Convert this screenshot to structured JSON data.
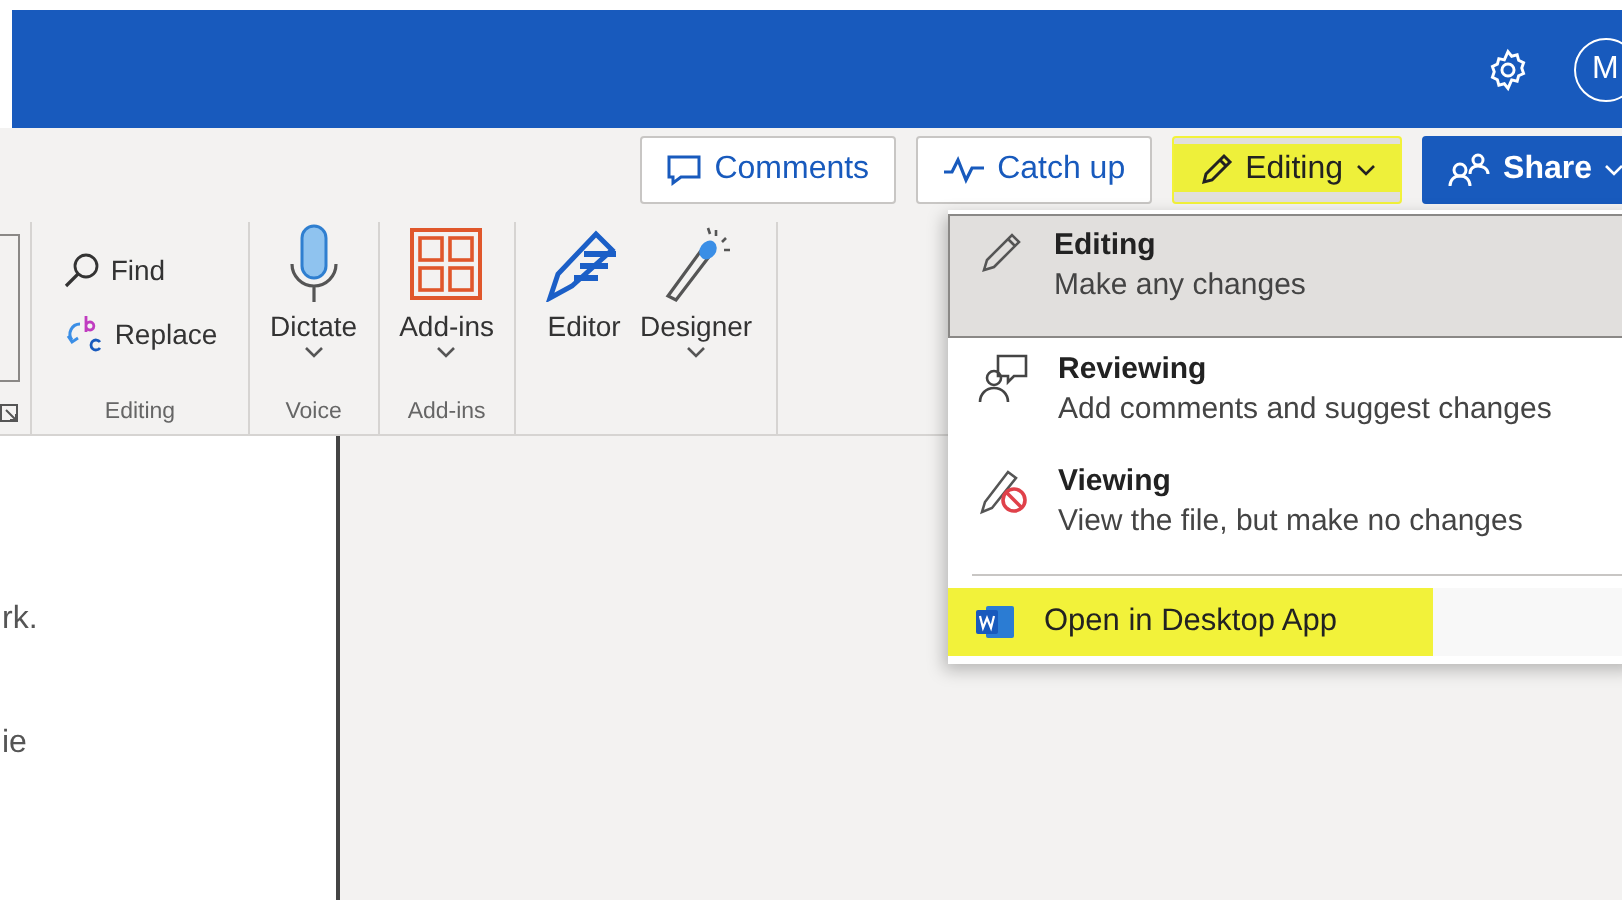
{
  "header": {
    "avatar_initial": "M"
  },
  "command_bar": [
    {
      "kind": "outline",
      "label": "Comments"
    },
    {
      "kind": "outline",
      "label": "Catch up"
    },
    {
      "kind": "mode",
      "label": "Editing",
      "expanded": true,
      "highlighted": true
    },
    {
      "kind": "primary",
      "label": "Share"
    }
  ],
  "ribbon": {
    "groups": [
      {
        "label": "Editing",
        "items": [
          {
            "kind": "small",
            "label": "Find"
          },
          {
            "kind": "small",
            "label": "Replace"
          }
        ]
      },
      {
        "label": "Voice",
        "items": [
          {
            "kind": "large",
            "label": "Dictate",
            "dropdown": true
          }
        ]
      },
      {
        "label": "Add-ins",
        "items": [
          {
            "kind": "large",
            "label": "Add-ins",
            "dropdown": true
          }
        ]
      },
      {
        "items": [
          {
            "kind": "large",
            "label": "Editor",
            "dropdown": false
          },
          {
            "kind": "large",
            "label": "Designer",
            "dropdown": true
          }
        ]
      }
    ]
  },
  "document": {
    "lines": [
      "rk.",
      "ie"
    ]
  },
  "mode_menu": {
    "items": [
      {
        "title": "Editing",
        "description": "Make any changes",
        "selected": true
      },
      {
        "title": "Reviewing",
        "description": "Add comments and suggest changes",
        "selected": false
      },
      {
        "title": "Viewing",
        "description": "View the file, but make no changes",
        "selected": false
      }
    ],
    "footer": {
      "label": "Open in Desktop App",
      "highlighted": true
    }
  }
}
